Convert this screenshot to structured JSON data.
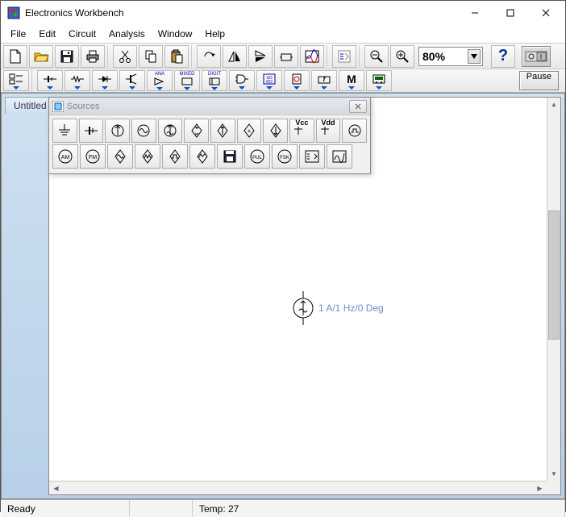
{
  "window": {
    "title": "Electronics Workbench"
  },
  "menu": {
    "file": "File",
    "edit": "Edit",
    "circuit": "Circuit",
    "analysis": "Analysis",
    "window": "Window",
    "help": "Help"
  },
  "toolbar": {
    "zoom": "80%",
    "help": "?",
    "pause": "Pause"
  },
  "document": {
    "tab": "Untitled"
  },
  "sources_panel": {
    "title": "Sources",
    "vcc": "Vcc",
    "vdd": "Vdd",
    "am": "AM",
    "fm": "FM",
    "pul": "PUL",
    "fsk": "FSK"
  },
  "placed_component": {
    "label": "1 A/1 Hz/0 Deg"
  },
  "status": {
    "ready": "Ready",
    "temp": "Temp: 27"
  },
  "comp_labels": {
    "ana": "ANA",
    "mixed": "MIXED",
    "digit": "DIGIT",
    "so": "SO",
    "ro": "RO",
    "m": "M"
  }
}
